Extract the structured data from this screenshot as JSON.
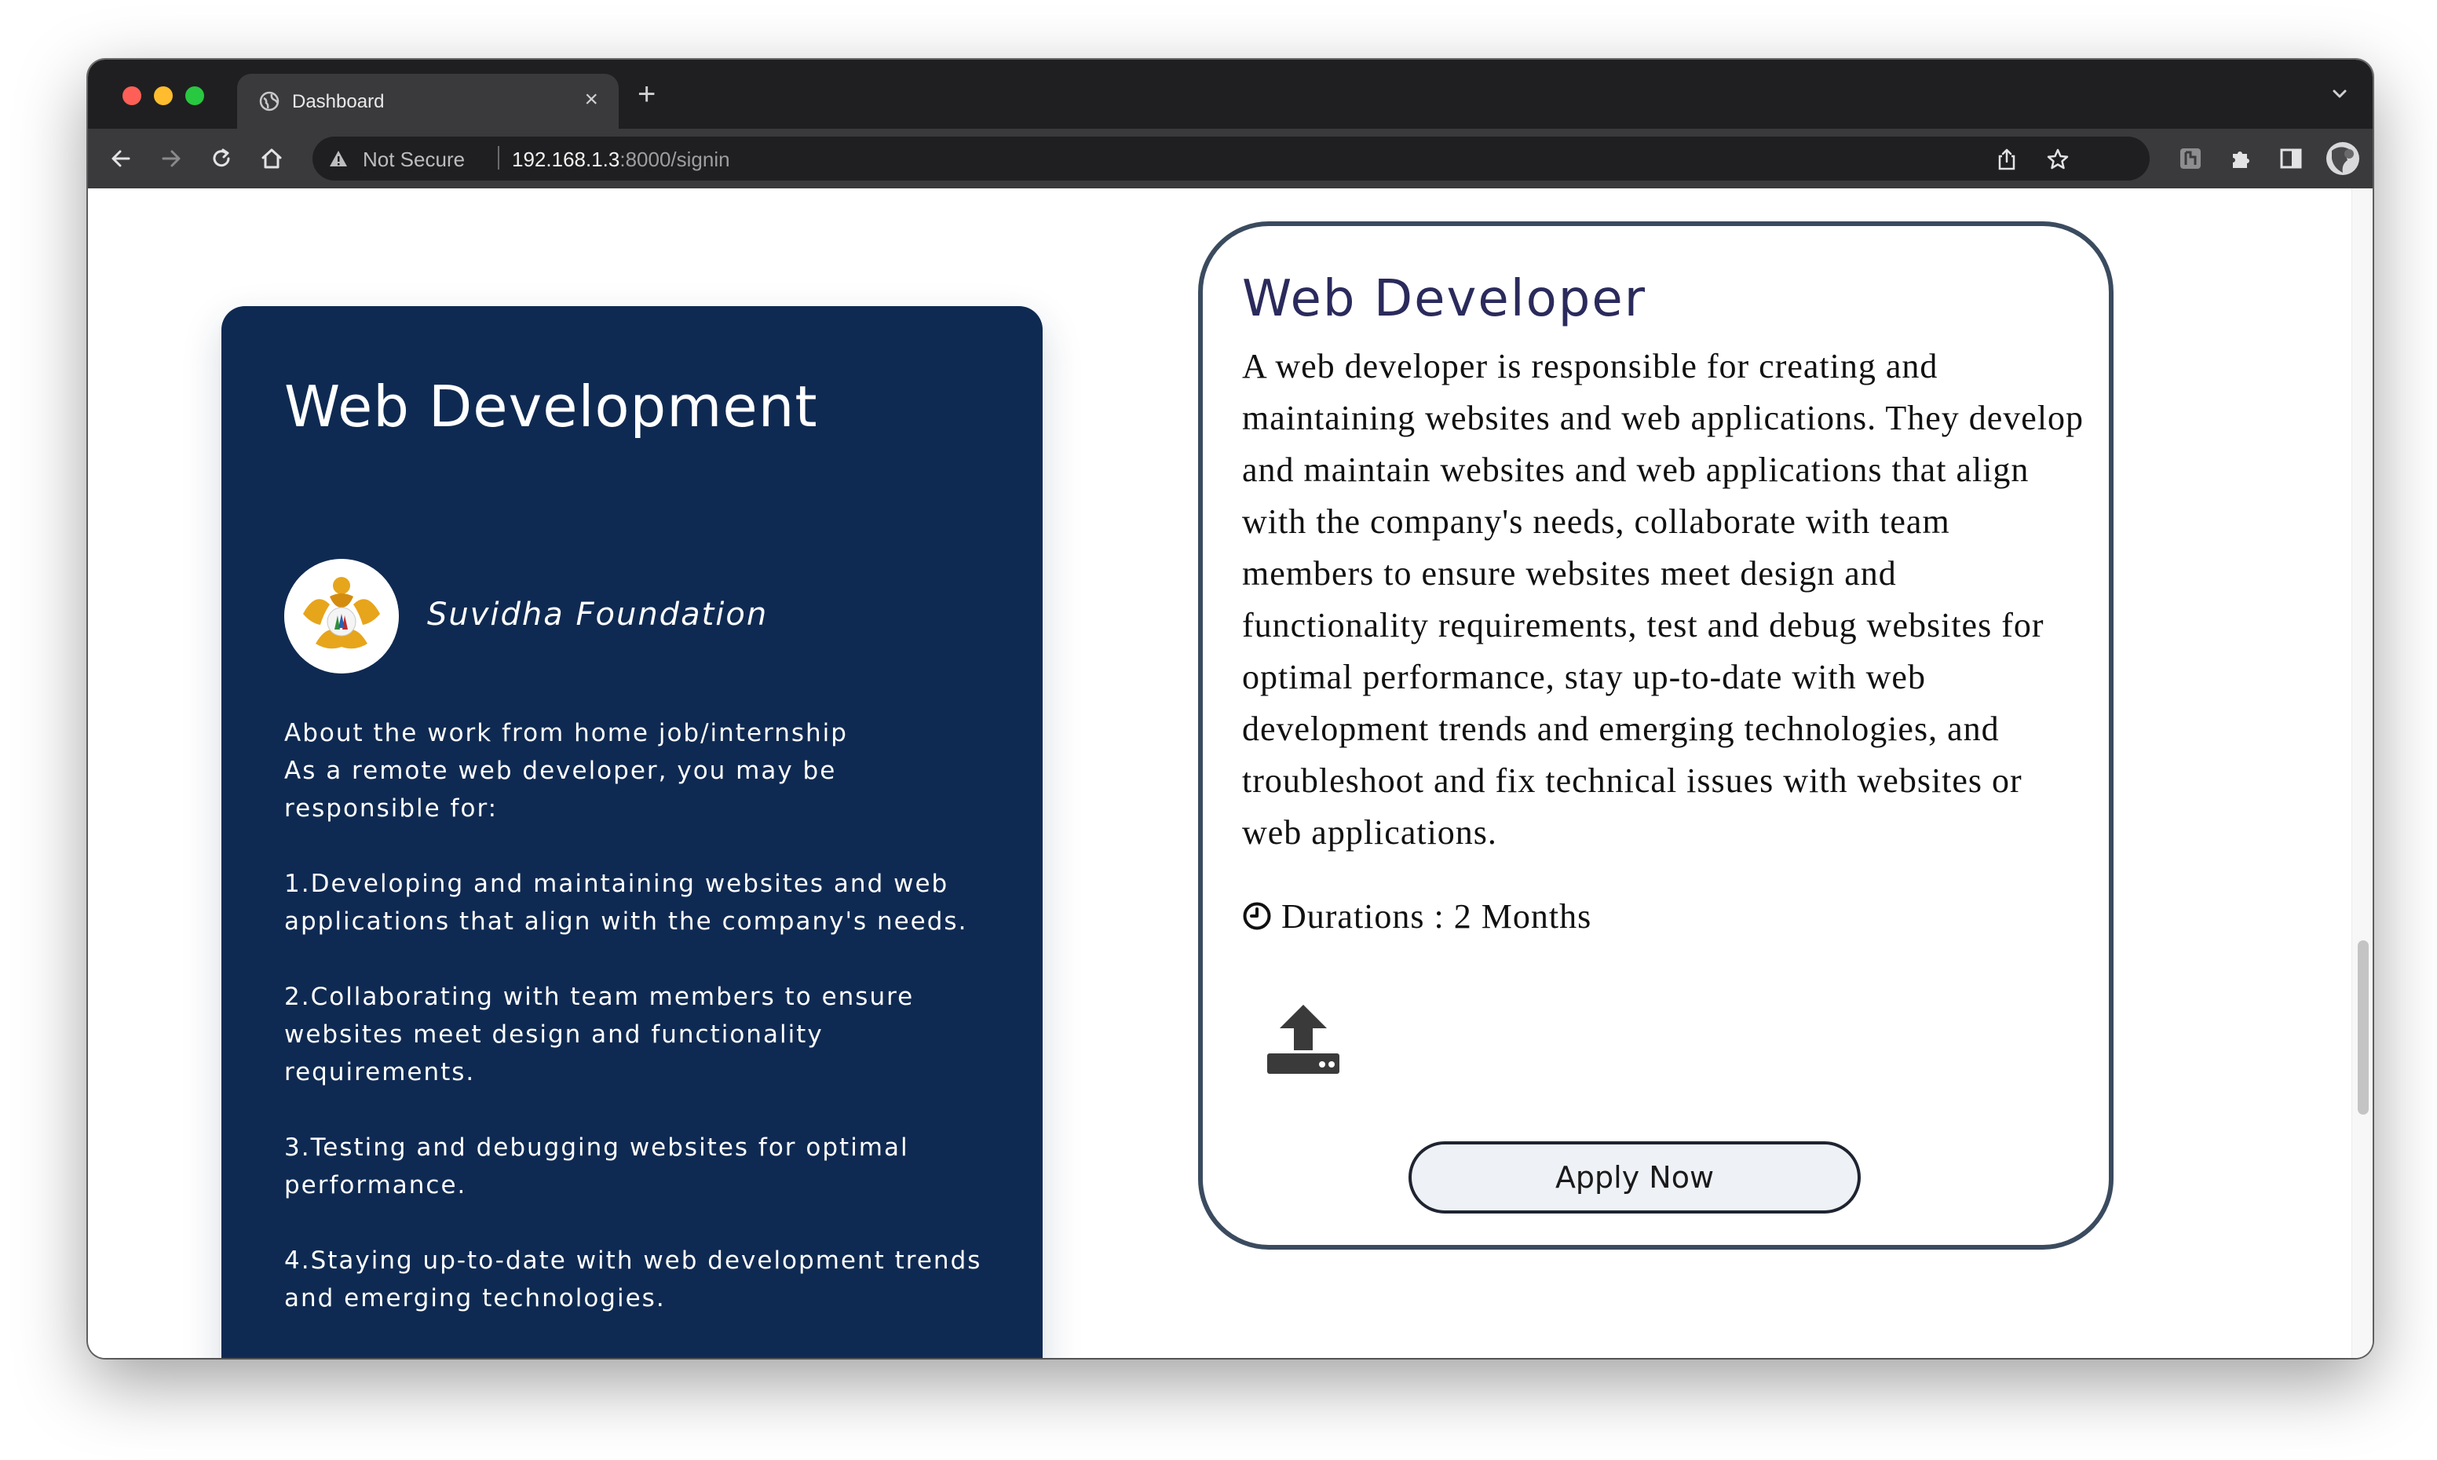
{
  "browser": {
    "tab_title": "Dashboard",
    "tab_close": "×",
    "new_tab": "+",
    "security_label": "Not Secure",
    "url_host": "192.168.1.3",
    "url_rest": ":8000/signin"
  },
  "left_card": {
    "title": "Web Development",
    "org_name": "Suvidha Foundation",
    "about_lines": [
      "About the work from home job/internship",
      "As a remote web developer, you may be responsible for:"
    ],
    "items": [
      "1.Developing and maintaining websites and web applications that align with the company's needs.",
      "2.Collaborating with team members to ensure websites meet design and functionality requirements.",
      "3.Testing and debugging websites for optimal performance.",
      "4.Staying up-to-date with web development trends and emerging technologies."
    ]
  },
  "right_card": {
    "title": "Web Developer",
    "description": "A web developer is responsible for creating and maintaining websites and web applications. They develop and maintain websites and web applications that align with the company's needs, collaborate with team members to ensure websites meet design and functionality requirements, test and debug websites for optimal performance, stay up-to-date with web development trends and emerging technologies, and troubleshoot and fix technical issues with websites or web applications.",
    "duration_label": "Durations : 2 Months",
    "apply_label": "Apply Now"
  },
  "icons": {
    "back": "arrow-left-icon",
    "forward": "arrow-right-icon",
    "reload": "reload-icon",
    "home": "home-icon",
    "warning": "warning-icon",
    "share": "share-icon",
    "bookmark": "star-icon",
    "extension": "puzzle-icon",
    "sidebar": "sidebar-icon",
    "profile": "avatar",
    "menu": "kebab-menu-icon",
    "clock": "clock-icon",
    "upload": "upload-icon"
  },
  "colors": {
    "card_navy": "#0f2a52",
    "title_indigo": "#2a2a5c",
    "card_border": "#3b4b5f",
    "button_bg": "#eef1f6"
  }
}
